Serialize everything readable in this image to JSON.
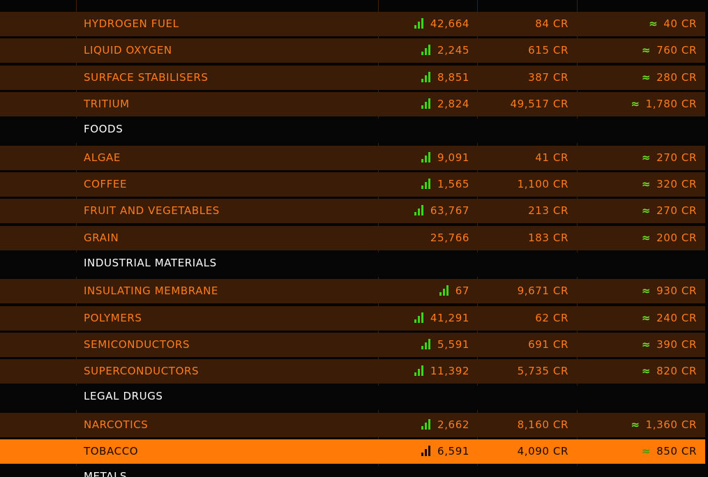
{
  "market": {
    "rows": [
      {
        "type": "item",
        "name": "HYDROGEN FUEL",
        "stock": "42,664",
        "price": "84 CR",
        "avg_symbol": "≈",
        "avg": "40 CR"
      },
      {
        "type": "item",
        "name": "LIQUID OXYGEN",
        "stock": "2,245",
        "price": "615 CR",
        "avg_symbol": "≈",
        "avg": "760 CR"
      },
      {
        "type": "item",
        "name": "SURFACE STABILISERS",
        "stock": "8,851",
        "price": "387 CR",
        "avg_symbol": "≈",
        "avg": "280 CR"
      },
      {
        "type": "item",
        "name": "TRITIUM",
        "stock": "2,824",
        "price": "49,517 CR",
        "avg_symbol": "≈",
        "avg": "1,780 CR"
      },
      {
        "type": "category",
        "name": "FOODS"
      },
      {
        "type": "item",
        "name": "ALGAE",
        "stock": "9,091",
        "price": "41 CR",
        "avg_symbol": "≈",
        "avg": "270 CR"
      },
      {
        "type": "item",
        "name": "COFFEE",
        "stock": "1,565",
        "price": "1,100 CR",
        "avg_symbol": "≈",
        "avg": "320 CR"
      },
      {
        "type": "item",
        "name": "FRUIT AND VEGETABLES",
        "stock": "63,767",
        "price": "213 CR",
        "avg_symbol": "≈",
        "avg": "270 CR"
      },
      {
        "type": "item",
        "name": "GRAIN",
        "stock": "25,766",
        "price": "183 CR",
        "avg_symbol": "≈",
        "avg": "200 CR",
        "no_bars": true
      },
      {
        "type": "category",
        "name": "INDUSTRIAL MATERIALS"
      },
      {
        "type": "item",
        "name": "INSULATING MEMBRANE",
        "stock": "67",
        "price": "9,671 CR",
        "avg_symbol": "≈",
        "avg": "930 CR"
      },
      {
        "type": "item",
        "name": "POLYMERS",
        "stock": "41,291",
        "price": "62 CR",
        "avg_symbol": "≈",
        "avg": "240 CR"
      },
      {
        "type": "item",
        "name": "SEMICONDUCTORS",
        "stock": "5,591",
        "price": "691 CR",
        "avg_symbol": "≈",
        "avg": "390 CR"
      },
      {
        "type": "item",
        "name": "SUPERCONDUCTORS",
        "stock": "11,392",
        "price": "5,735 CR",
        "avg_symbol": "≈",
        "avg": "820 CR"
      },
      {
        "type": "category",
        "name": "LEGAL DRUGS"
      },
      {
        "type": "item",
        "name": "NARCOTICS",
        "stock": "2,662",
        "price": "8,160 CR",
        "avg_symbol": "≈",
        "avg": "1,360 CR"
      },
      {
        "type": "item",
        "name": "TOBACCO",
        "stock": "6,591",
        "price": "4,090 CR",
        "avg_symbol": "≈",
        "avg": "850 CR",
        "selected": true
      },
      {
        "type": "category",
        "name": "METALS"
      }
    ],
    "colors": {
      "item_bg": "#3a1c07",
      "category_bg": "#060606",
      "selected_bg": "#ff7a06",
      "text_orange": "#ff7c1f",
      "supply_green": "#39d61a"
    },
    "icons": {
      "supply": "supply-level-bars-icon",
      "approx": "approximately-icon"
    }
  }
}
